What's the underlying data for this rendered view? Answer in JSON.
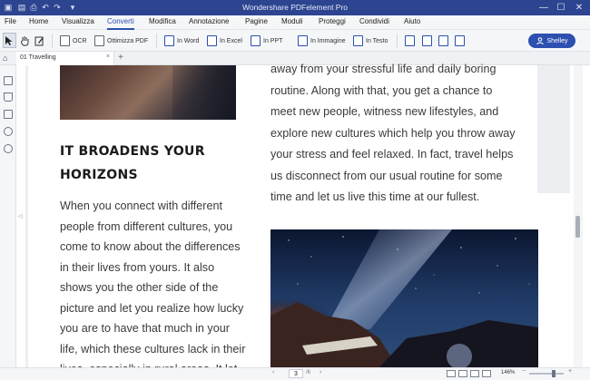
{
  "window": {
    "title": "Wondershare PDFelement Pro",
    "controls": {
      "minimize": "—",
      "maximize": "☐",
      "close": "✕"
    }
  },
  "quick_access": [
    "save-icon",
    "print-icon",
    "undo-icon",
    "redo-icon",
    "dropdown-icon"
  ],
  "menu": {
    "items": [
      "File",
      "Home",
      "Visualizza",
      "Converti",
      "Modifica",
      "Annotazione",
      "Pagine",
      "Moduli",
      "Proteggi",
      "Condividi",
      "Aiuto"
    ],
    "active": "Converti"
  },
  "toolbar": {
    "ocr": "OCR",
    "optimize": "Ottimizza PDF",
    "to_word": "In Word",
    "to_excel": "In Excel",
    "to_ppt": "In PPT",
    "to_image": "In Immagine",
    "to_text": "In Testo",
    "user": "Shelley"
  },
  "tabs": {
    "document": "01 Travelling",
    "close": "×",
    "add": "+"
  },
  "document": {
    "heading_line1": "IT BROADENS YOUR",
    "heading_line2": "HORIZONS",
    "left_lines": [
      "When you connect with different",
      "people from different cultures, you",
      "come to know about the differences",
      "in their lives from yours. It also",
      "shows you the other side of the",
      "picture and let you realize how lucky",
      "you are to have that much in your",
      "life, which these cultures lack in their",
      "lives, especially in rural areas. It let"
    ],
    "right_lines": [
      "away from your stressful life and daily boring",
      "routine. Along with that, you get a chance to",
      "meet new people, witness new lifestyles, and",
      "explore new cultures which help you throw away",
      "your stress and feel relaxed. In fact, travel helps",
      "us disconnect from our usual routine for some",
      "time and let us live this time at our fullest."
    ]
  },
  "status": {
    "page": "3",
    "total": "/6",
    "zoom": "146%"
  },
  "colors": {
    "brand": "#2d4490",
    "accent": "#2d4fb0"
  }
}
